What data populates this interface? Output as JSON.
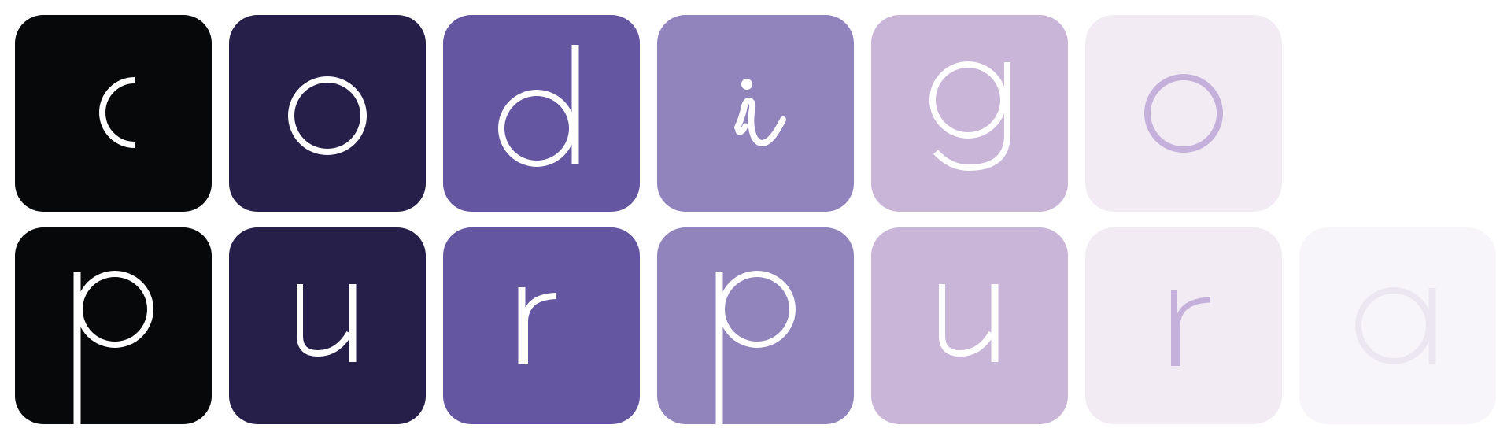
{
  "row1": {
    "tiles": [
      {
        "letter": "c",
        "bg": "#06080a",
        "fg": "#ffffff"
      },
      {
        "letter": "o",
        "bg": "#251f4a",
        "fg": "#ffffff"
      },
      {
        "letter": "d",
        "bg": "#6456a0",
        "fg": "#ffffff"
      },
      {
        "letter": "i",
        "bg": "#9184bd",
        "fg": "#ffffff"
      },
      {
        "letter": "g",
        "bg": "#c8b5d8",
        "fg": "#ffffff"
      },
      {
        "letter": "o",
        "bg": "#f2ebf4",
        "fg": "#c4b0da"
      }
    ]
  },
  "row2": {
    "tiles": [
      {
        "letter": "p",
        "bg": "#06080a",
        "fg": "#ffffff"
      },
      {
        "letter": "u",
        "bg": "#251f4a",
        "fg": "#ffffff"
      },
      {
        "letter": "r",
        "bg": "#6456a0",
        "fg": "#ffffff"
      },
      {
        "letter": "p",
        "bg": "#9184bd",
        "fg": "#ffffff"
      },
      {
        "letter": "u",
        "bg": "#c8b5d8",
        "fg": "#ffffff"
      },
      {
        "letter": "r",
        "bg": "#f2ebf4",
        "fg": "#c4b0da"
      },
      {
        "letter": "a",
        "bg": "#f7f5f9",
        "fg": "#ece6f1"
      }
    ]
  }
}
